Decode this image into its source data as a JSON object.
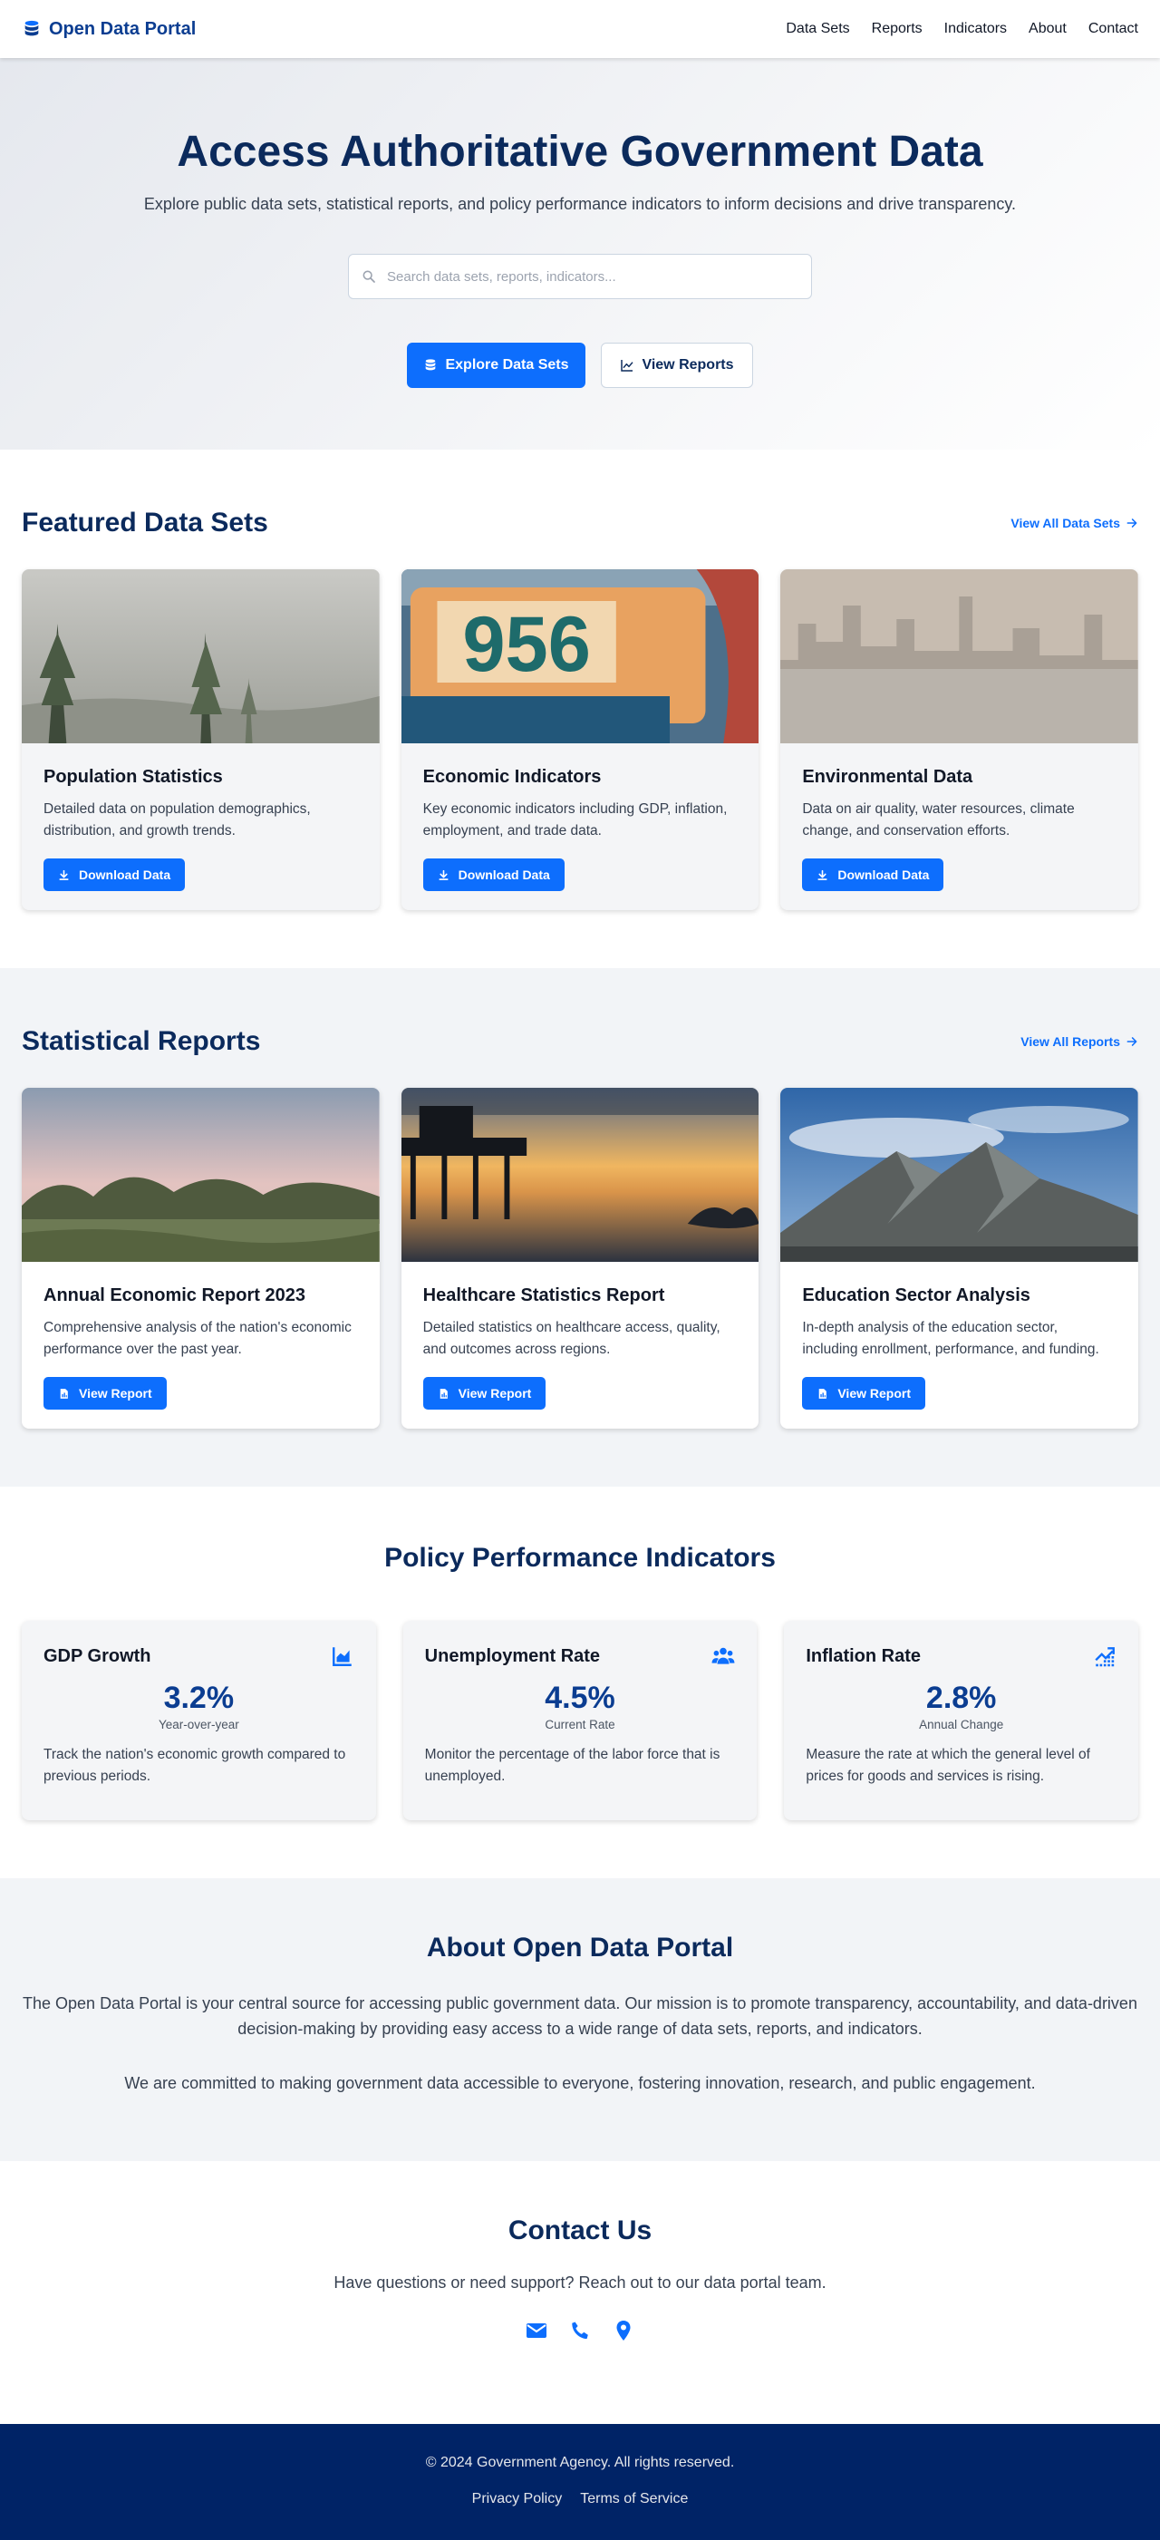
{
  "nav": {
    "brand": "Open Data Portal",
    "links": [
      "Data Sets",
      "Reports",
      "Indicators",
      "About",
      "Contact"
    ]
  },
  "hero": {
    "title": "Access Authoritative Government Data",
    "subtitle": "Explore public data sets, statistical reports, and policy performance indicators to inform decisions and drive transparency.",
    "search_placeholder": "Search data sets, reports, indicators...",
    "primary_button": "Explore Data Sets",
    "secondary_button": "View Reports"
  },
  "datasets": {
    "title": "Featured Data Sets",
    "view_all": "View All Data Sets",
    "items": [
      {
        "title": "Population Statistics",
        "description": "Detailed data on population demographics, distribution, and growth trends.",
        "button": "Download Data"
      },
      {
        "title": "Economic Indicators",
        "description": "Key economic indicators including GDP, inflation, employment, and trade data.",
        "button": "Download Data"
      },
      {
        "title": "Environmental Data",
        "description": "Data on air quality, water resources, climate change, and conservation efforts.",
        "button": "Download Data"
      }
    ]
  },
  "reports": {
    "title": "Statistical Reports",
    "view_all": "View All Reports",
    "items": [
      {
        "title": "Annual Economic Report 2023",
        "description": "Comprehensive analysis of the nation's economic performance over the past year.",
        "button": "View Report"
      },
      {
        "title": "Healthcare Statistics Report",
        "description": "Detailed statistics on healthcare access, quality, and outcomes across regions.",
        "button": "View Report"
      },
      {
        "title": "Education Sector Analysis",
        "description": "In-depth analysis of the education sector, including enrollment, performance, and funding.",
        "button": "View Report"
      }
    ]
  },
  "indicators": {
    "title": "Policy Performance Indicators",
    "items": [
      {
        "title": "GDP Growth",
        "value": "3.2%",
        "sub": "Year-over-year",
        "description": "Track the nation's economic growth compared to previous periods.",
        "icon": "area-chart-icon"
      },
      {
        "title": "Unemployment Rate",
        "value": "4.5%",
        "sub": "Current Rate",
        "description": "Monitor the percentage of the labor force that is unemployed.",
        "icon": "users-icon"
      },
      {
        "title": "Inflation Rate",
        "value": "2.8%",
        "sub": "Annual Change",
        "description": "Measure the rate at which the general level of prices for goods and services is rising.",
        "icon": "trend-up-icon"
      }
    ]
  },
  "about": {
    "title": "About Open Data Portal",
    "p1": "The Open Data Portal is your central source for accessing public government data. Our mission is to promote transparency, accountability, and data-driven decision-making by providing easy access to a wide range of data sets, reports, and indicators.",
    "p2": "We are committed to making government data accessible to everyone, fostering innovation, research, and public engagement."
  },
  "contact": {
    "title": "Contact Us",
    "text": "Have questions or need support? Reach out to our data portal team.",
    "icons": [
      "envelope-icon",
      "phone-icon",
      "map-pin-icon"
    ]
  },
  "footer": {
    "copyright": "© 2024 Government Agency. All rights reserved.",
    "links": [
      "Privacy Policy",
      "Terms of Service"
    ]
  },
  "colors": {
    "primary": "#0d6efd",
    "navy": "#0b2a5c",
    "footer_bg": "#002366"
  }
}
